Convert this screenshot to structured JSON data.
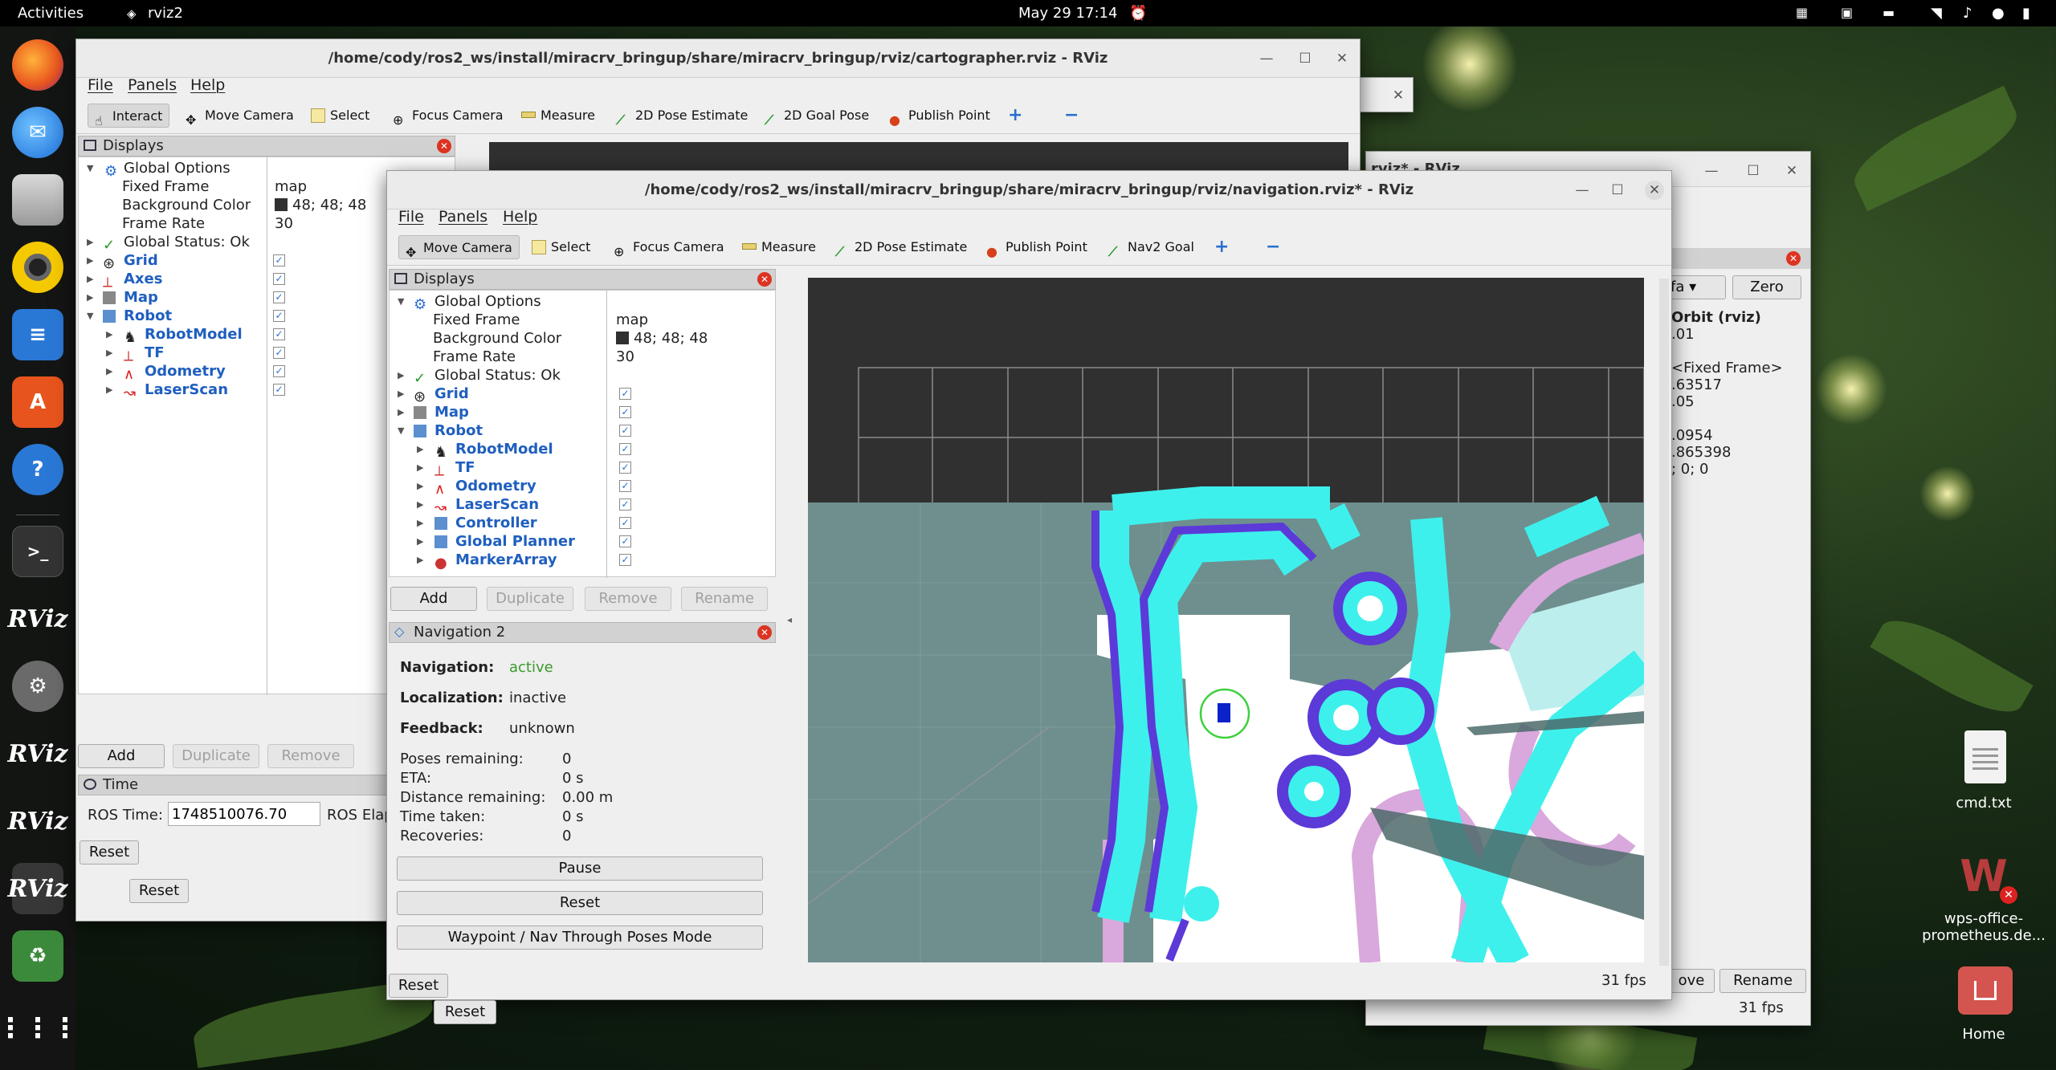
{
  "topbar": {
    "activities": "Activities",
    "app_name": "rviz2",
    "datetime": "May 29  17:14"
  },
  "desktop": {
    "file_label": "cmd.txt",
    "wps_label": "wps-office-\nprometheus.de...",
    "home_label": "Home"
  },
  "dock": {
    "items": [
      "firefox-icon",
      "thunderbird-icon",
      "files-icon",
      "rhythmbox-icon",
      "writer-icon",
      "app-center-icon",
      "help-icon",
      "terminal-icon",
      "rviz-icon",
      "settings-icon",
      "rviz-icon",
      "rviz-icon",
      "rviz-icon",
      "trash-icon",
      "app-grid-icon"
    ],
    "rviz_text": "RViz"
  },
  "win_cart": {
    "title": "/home/cody/ros2_ws/install/miracrv_bringup/share/miracrv_bringup/rviz/cartographer.rviz - RViz",
    "menu": [
      "File",
      "Panels",
      "Help"
    ],
    "tools": [
      "Interact",
      "Move Camera",
      "Select",
      "Focus Camera",
      "Measure",
      "2D Pose Estimate",
      "2D Goal Pose",
      "Publish Point"
    ],
    "displays_title": "Displays",
    "global_options": "Global Options",
    "fixed_frame_label": "Fixed Frame",
    "fixed_frame_value": "map",
    "bg_color_label": "Background Color",
    "bg_color_value": "48; 48; 48",
    "frame_rate_label": "Frame Rate",
    "frame_rate_value": "30",
    "global_status": "Global Status: Ok",
    "items": [
      "Grid",
      "Axes",
      "Map",
      "Robot",
      "RobotModel",
      "TF",
      "Odometry",
      "LaserScan"
    ],
    "buttons": [
      "Add",
      "Duplicate",
      "Remove"
    ],
    "time_title": "Time",
    "ros_time_label": "ROS Time:",
    "ros_time_value": "1748510076.70",
    "ros_elapsed_label": "ROS Elap",
    "reset": "Reset"
  },
  "win_back": {
    "title": "rviz* - RViz",
    "dropdown": "fa",
    "zero": "Zero",
    "lines": [
      "Orbit (rviz)",
      ".01",
      "",
      "<Fixed Frame>",
      ".63517",
      ".05",
      "",
      ".0954",
      ".865398",
      "; 0; 0"
    ],
    "rename": "Rename",
    "ove": "ove",
    "fps": "31 fps",
    "reset": "Reset"
  },
  "win_nav": {
    "title": "/home/cody/ros2_ws/install/miracrv_bringup/share/miracrv_bringup/rviz/navigation.rviz* - RViz",
    "menu": [
      "File",
      "Panels",
      "Help"
    ],
    "tools": [
      "Move Camera",
      "Select",
      "Focus Camera",
      "Measure",
      "2D Pose Estimate",
      "Publish Point",
      "Nav2 Goal"
    ],
    "displays_title": "Displays",
    "global_options": "Global Options",
    "fixed_frame_label": "Fixed Frame",
    "fixed_frame_value": "map",
    "bg_color_label": "Background Color",
    "bg_color_value": "48; 48; 48",
    "frame_rate_label": "Frame Rate",
    "frame_rate_value": "30",
    "global_status": "Global Status: Ok",
    "items": [
      "Grid",
      "Map",
      "Robot",
      "RobotModel",
      "TF",
      "Odometry",
      "LaserScan",
      "Controller",
      "Global Planner",
      "MarkerArray"
    ],
    "buttons": [
      "Add",
      "Duplicate",
      "Remove",
      "Rename"
    ],
    "nav2_title": "Navigation 2",
    "navigation_label": "Navigation:",
    "navigation_value": "active",
    "localization_label": "Localization:",
    "localization_value": "inactive",
    "feedback_label": "Feedback:",
    "feedback_value": "unknown",
    "poses_label": "Poses remaining:",
    "poses_value": "0",
    "eta_label": "ETA:",
    "eta_value": "0 s",
    "distance_label": "Distance remaining:",
    "distance_value": "0.00 m",
    "time_label": "Time taken:",
    "time_value": "0 s",
    "recoveries_label": "Recoveries:",
    "recoveries_value": "0",
    "pause": "Pause",
    "reset_nav": "Reset",
    "waypoint": "Waypoint / Nav Through Poses Mode",
    "reset": "Reset",
    "fps": "31 fps",
    "reset_behind": "Reset"
  },
  "colors": {
    "costmap_cyan": "#3ef0ec",
    "costmap_purple": "#5b3ad8",
    "costmap_pink": "#d9a8dc",
    "map_free": "#ffffff",
    "map_unknown": "#6e8f8e",
    "background": "#303030"
  }
}
